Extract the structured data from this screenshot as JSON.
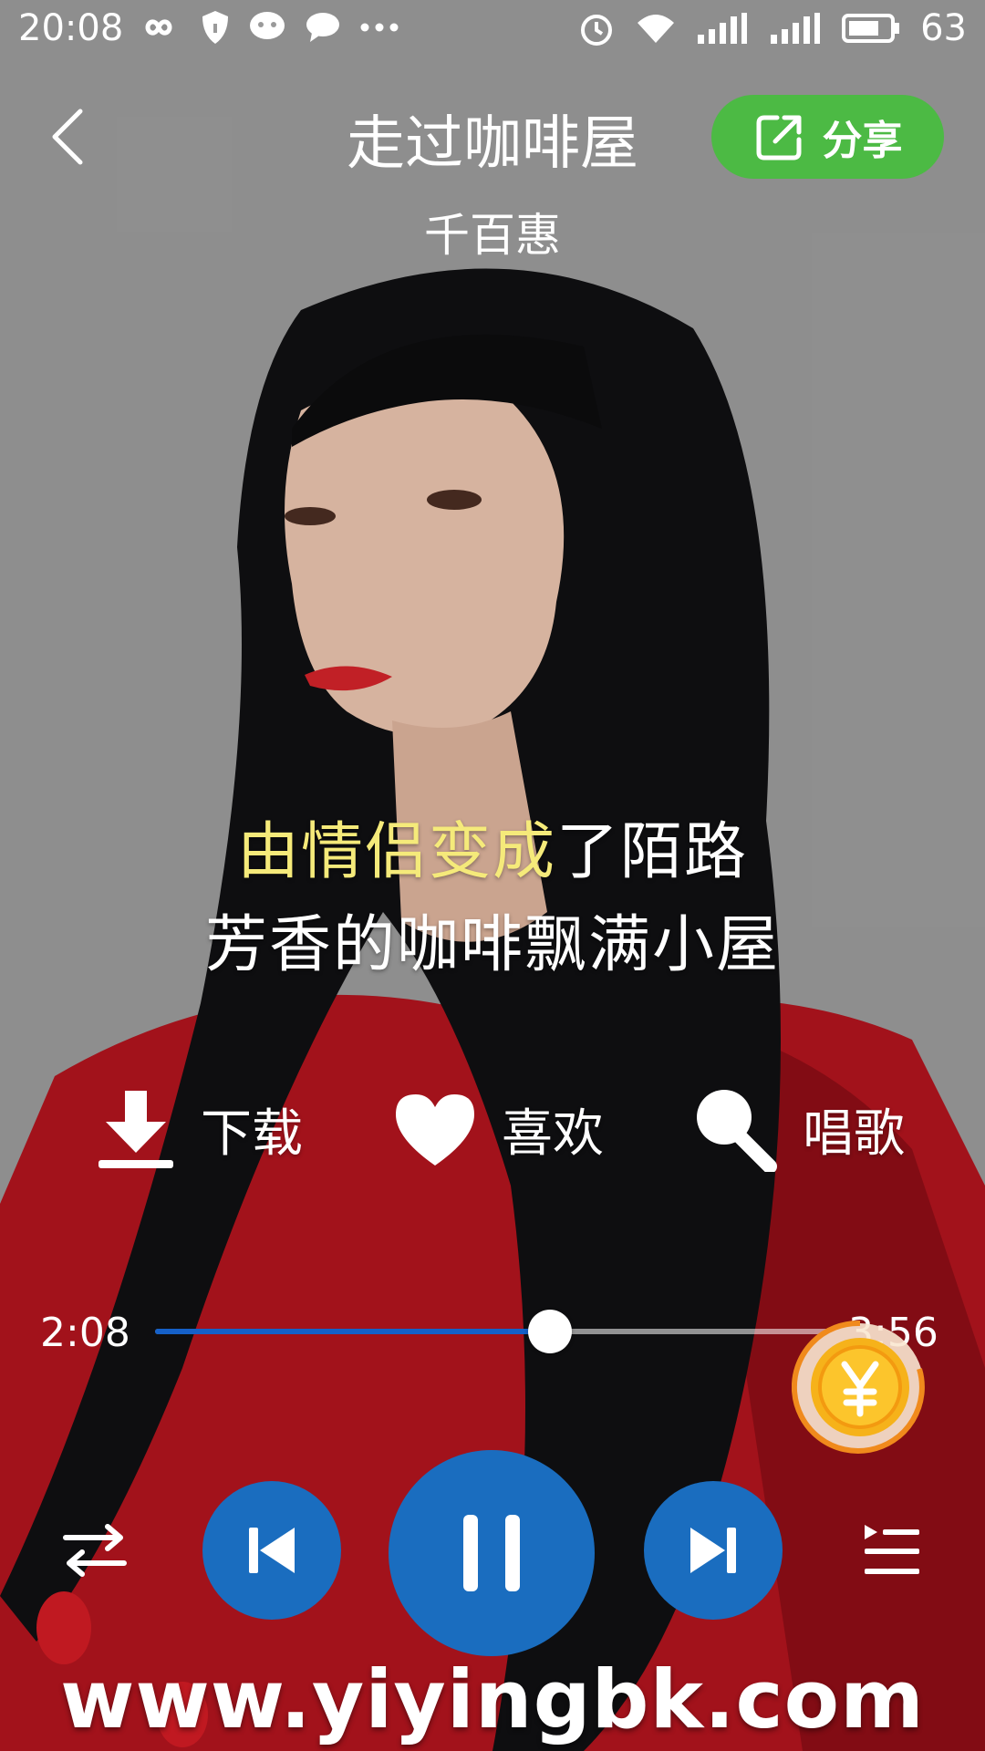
{
  "status_bar": {
    "time": "20:08",
    "battery": "63"
  },
  "header": {
    "title": "走过咖啡屋",
    "share_label": "分享",
    "artist": "千百惠"
  },
  "lyrics": {
    "line1_highlighted": "由情侣变成",
    "line1_rest": "了陌路",
    "line2": "芳香的咖啡飘满小屋"
  },
  "actions": {
    "download_label": "下载",
    "like_label": "喜欢",
    "sing_label": "唱歌"
  },
  "progress": {
    "elapsed": "2:08",
    "total": "3:56",
    "fraction": 0.585
  },
  "watermark": "www.yiyingbk.com",
  "colors": {
    "accent_blue": "#1a6dbf",
    "share_green": "#4cba44",
    "lyric_highlight": "#f5ea7a",
    "coin_gold": "#f6b21a"
  }
}
